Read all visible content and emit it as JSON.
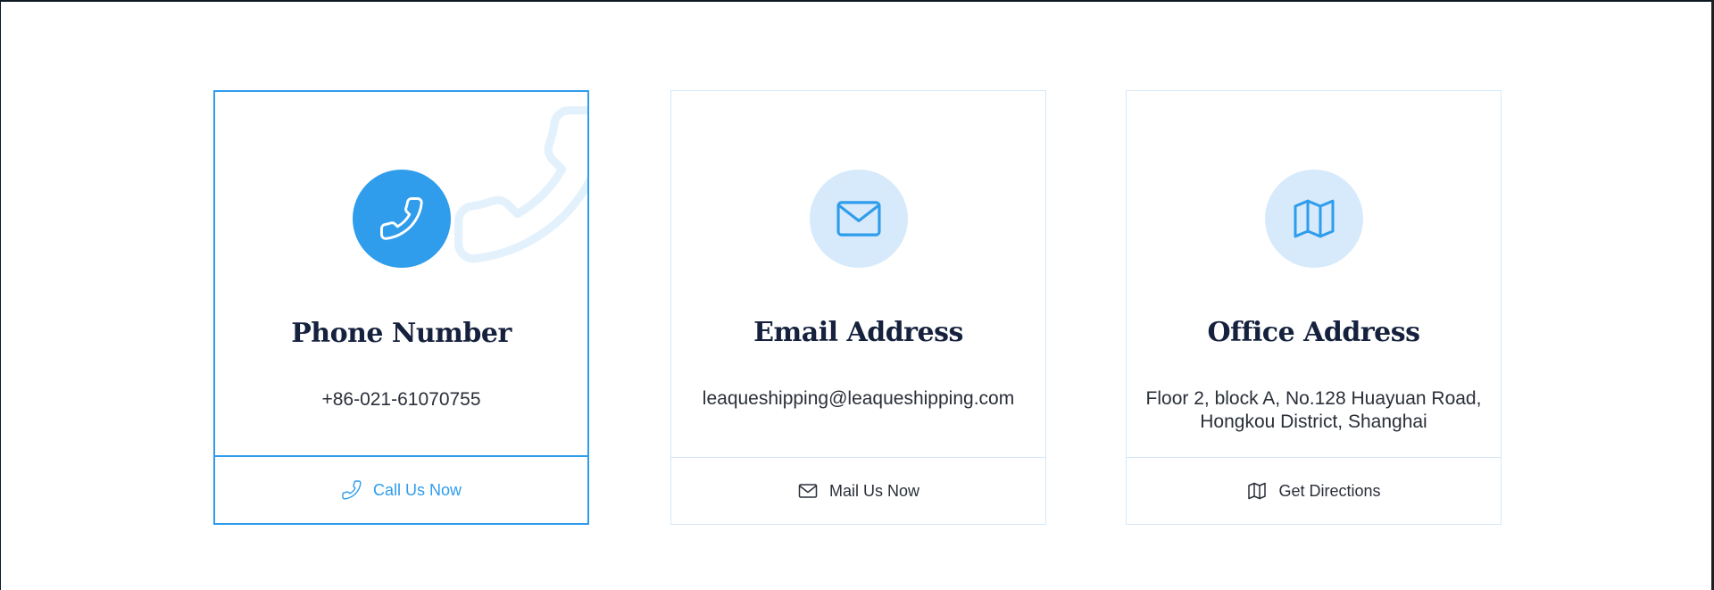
{
  "colors": {
    "accent": "#2f9cec",
    "accent_light": "#d6eafb",
    "border": "#d5e8f8",
    "title": "#15213d",
    "text": "#2a2f38"
  },
  "cards": [
    {
      "icon": "phone-icon",
      "title": "Phone Number",
      "value": "+86-021-61070755",
      "action": "Call Us Now",
      "active": true
    },
    {
      "icon": "envelope-icon",
      "title": "Email Address",
      "value": "leaqueshipping@leaqueshipping.com",
      "action": "Mail Us Now",
      "active": false
    },
    {
      "icon": "map-icon",
      "title": "Office Address",
      "value": "Floor 2, block A, No.128 Huayuan Road, Hongkou District, Shanghai",
      "action": "Get Directions",
      "active": false
    }
  ]
}
